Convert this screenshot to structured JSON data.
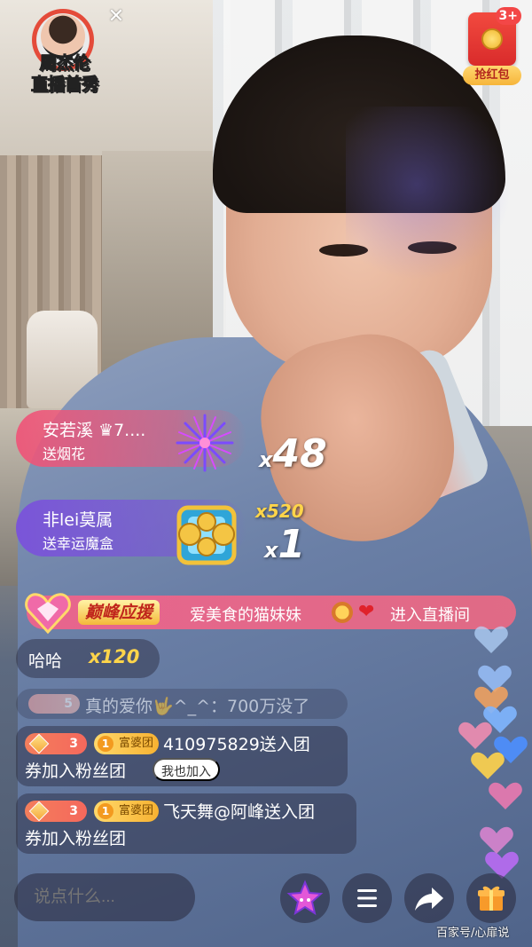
{
  "colors": {
    "gift1_bg": "#ef5478",
    "gift2_bg": "#7a50dc",
    "combo_gold": "#ffd54a",
    "entry_bg": "#ee638c",
    "red_packet": "#e23a35"
  },
  "show_badge": {
    "line1": "周杰伦",
    "line2": "直播首秀",
    "close_icon": "close-icon"
  },
  "red_packet": {
    "badge": "3+",
    "label": "抢红包"
  },
  "gifts": [
    {
      "sender": "安若溪 ♛7....",
      "action": "送烟花",
      "icon": "firework-icon",
      "combo_prefix": "x",
      "combo": "48"
    },
    {
      "sender": "非lei莫属",
      "action": "送幸运魔盒",
      "icon": "magic-box-icon",
      "extra": "x520",
      "combo_prefix": "x",
      "combo": "1"
    }
  ],
  "entry": {
    "tag": "巅峰应援",
    "user": "爱美食的猫妹妹",
    "action": "进入直播间"
  },
  "chat": {
    "haha": {
      "text": "哈哈",
      "count": "x120"
    },
    "love": {
      "level": "5",
      "text": "真的爱你🤟^_^：700万没了"
    },
    "fans": [
      {
        "level": "3",
        "group_num": "1",
        "group": "富婆团",
        "line1": "410975829送入团",
        "line2": "券加入粉丝团",
        "join": "我也加入"
      },
      {
        "level": "3",
        "group_num": "1",
        "group": "富婆团",
        "line1": "飞天舞@阿峰送入团",
        "line2": "券加入粉丝团"
      }
    ]
  },
  "bottom": {
    "placeholder": "说点什么...",
    "watermark": "百家号/心扉说"
  }
}
